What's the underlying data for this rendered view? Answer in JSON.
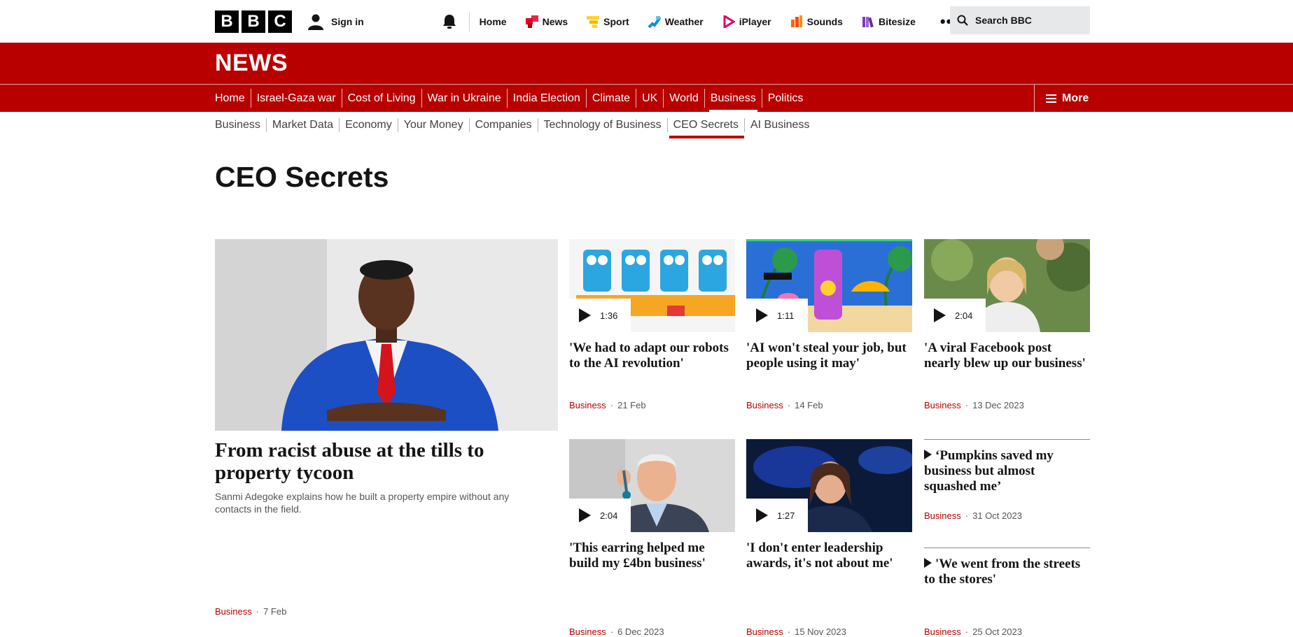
{
  "global": {
    "logo_letters": [
      "B",
      "B",
      "C"
    ],
    "signin": "Sign in",
    "nav": [
      {
        "label": "Home",
        "icon": "none"
      },
      {
        "label": "News",
        "icon": "news-icon",
        "color": "#e4002b"
      },
      {
        "label": "Sport",
        "icon": "sport-icon",
        "color": "#ffd230"
      },
      {
        "label": "Weather",
        "icon": "weather-icon",
        "color": "#0f8fd6"
      },
      {
        "label": "iPlayer",
        "icon": "iplayer-icon",
        "color": "#e4006d"
      },
      {
        "label": "Sounds",
        "icon": "sounds-icon",
        "color": "#ff6600"
      },
      {
        "label": "Bitesize",
        "icon": "bitesize-icon",
        "color": "#7e3ab7"
      }
    ],
    "more_glyph": "•••",
    "search_placeholder": "Search BBC"
  },
  "news": {
    "title": "NEWS",
    "section_nav": [
      "Home",
      "Israel-Gaza war",
      "Cost of Living",
      "War in Ukraine",
      "India Election",
      "Climate",
      "UK",
      "World",
      "Business",
      "Politics"
    ],
    "section_active": "Business",
    "more_label": "More",
    "sub_nav": [
      "Business",
      "Market Data",
      "Economy",
      "Your Money",
      "Companies",
      "Technology of Business",
      "CEO Secrets",
      "AI Business"
    ],
    "sub_active": "CEO Secrets"
  },
  "page": {
    "title": "CEO Secrets"
  },
  "lead": {
    "headline": "From racist abuse at the tills to property tycoon",
    "summary": "Sanmi Adegoke explains how he built a property empire without any contacts in the field.",
    "topic": "Business",
    "date": "7 Feb"
  },
  "cards": [
    {
      "headline": "'We had to adapt our robots to the AI revolution'",
      "duration": "1:36",
      "topic": "Business",
      "date": "21 Feb"
    },
    {
      "headline": "'AI won't steal your job, but people using it may'",
      "duration": "1:11",
      "topic": "Business",
      "date": "14 Feb"
    },
    {
      "headline": "'A viral Facebook post nearly blew up our business'",
      "duration": "2:04",
      "topic": "Business",
      "date": "13 Dec 2023"
    },
    {
      "headline": "'This earring helped me build my £4bn business'",
      "duration": "2:04",
      "topic": "Business",
      "date": "6 Dec 2023"
    },
    {
      "headline": "'I don't enter leadership awards, it's not about me'",
      "duration": "1:27",
      "topic": "Business",
      "date": "15 Nov 2023"
    }
  ],
  "text_cards": [
    {
      "headline": "‘Pumpkins saved my business but almost squashed me’",
      "topic": "Business",
      "date": "31 Oct 2023"
    },
    {
      "headline": "'We went from the streets to the stores'",
      "topic": "Business",
      "date": "25 Oct 2023"
    }
  ],
  "colors": {
    "brand_red": "#b80000",
    "text": "#141414",
    "meta_grey": "#545658"
  }
}
